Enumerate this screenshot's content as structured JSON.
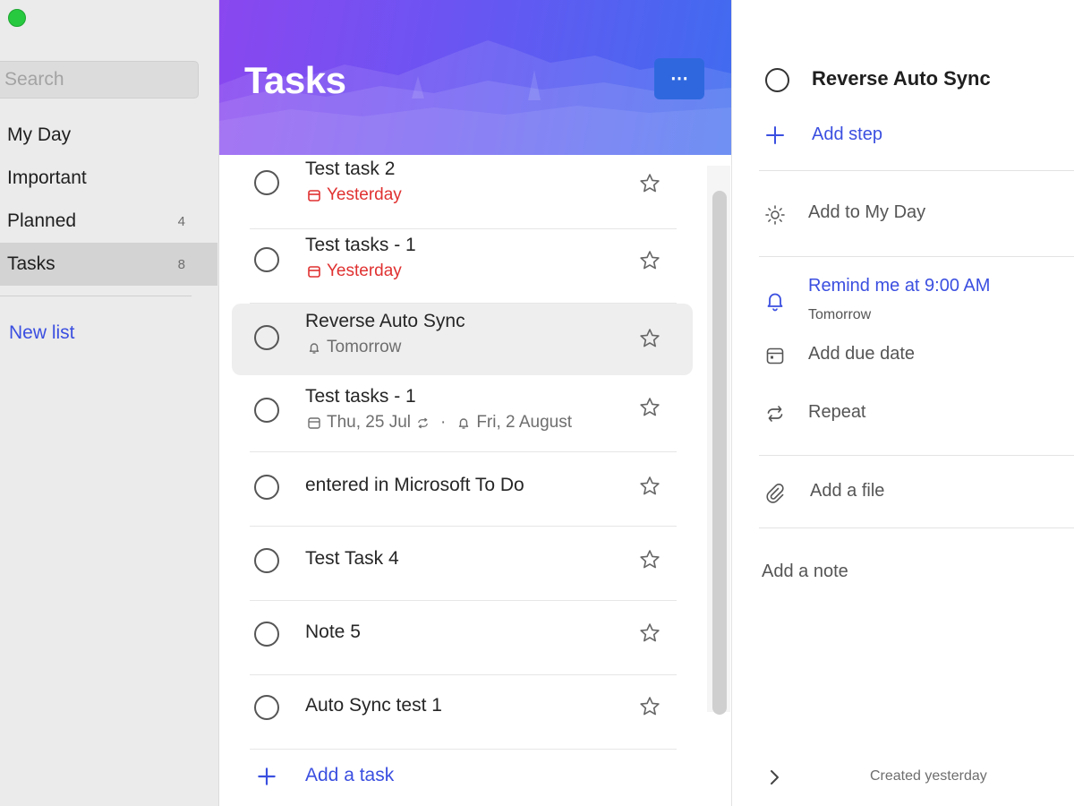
{
  "sidebar": {
    "search_placeholder": "Search",
    "items": [
      {
        "label": "My Day",
        "count": ""
      },
      {
        "label": "Important",
        "count": ""
      },
      {
        "label": "Planned",
        "count": "4"
      },
      {
        "label": "Tasks",
        "count": "8"
      }
    ],
    "new_list": "New list"
  },
  "list": {
    "title": "Tasks",
    "more_label": "⋯",
    "tasks": [
      {
        "title": "Test task 2",
        "meta": "Yesterday"
      },
      {
        "title": "Test tasks - 1",
        "meta": "Yesterday"
      },
      {
        "title": "Reverse Auto Sync",
        "meta": "Tomorrow"
      },
      {
        "title": "Test tasks - 1",
        "meta_date": "Thu, 25 Jul",
        "meta_sep": "·",
        "meta_reminder": "Fri, 2 August"
      },
      {
        "title": "entered in Microsoft To Do"
      },
      {
        "title": "Test Task 4"
      },
      {
        "title": "Note 5"
      },
      {
        "title": "Auto Sync test 1"
      }
    ],
    "add_task": "Add a task"
  },
  "detail": {
    "title": "Reverse Auto Sync",
    "add_step": "Add step",
    "add_my_day": "Add to My Day",
    "remind": "Remind me at 9:00 AM",
    "remind_sub": "Tomorrow",
    "due": "Add due date",
    "repeat": "Repeat",
    "file": "Add a file",
    "note": "Add a note",
    "created": "Created yesterday"
  },
  "colors": {
    "accent": "#3b4fe0",
    "overdue": "#e03131",
    "header_start": "#8a47f0",
    "header_end": "#3f6cf0",
    "traffic_light": "#27c93f"
  },
  "icons": [
    "search-icon",
    "calendar-icon",
    "bell-icon",
    "repeat-icon",
    "star-icon",
    "plus-icon",
    "sun-icon",
    "paperclip-icon",
    "chevron-right-icon",
    "more-icon"
  ]
}
